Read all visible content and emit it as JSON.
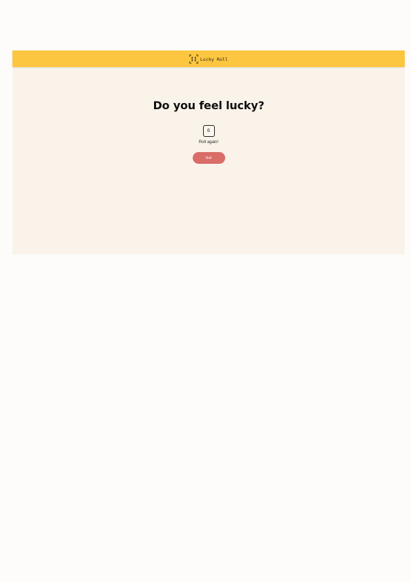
{
  "app": {
    "name": "Lucky Roll",
    "icon": "dice-icon"
  },
  "main": {
    "headline": "Do you feel lucky?",
    "die_value": "6",
    "status_text": "Roll again!",
    "roll_button_label": "Roll"
  },
  "colors": {
    "header": "#fdc640",
    "background": "#f9f3ea",
    "button": "#d96d68",
    "text": "#111111"
  }
}
